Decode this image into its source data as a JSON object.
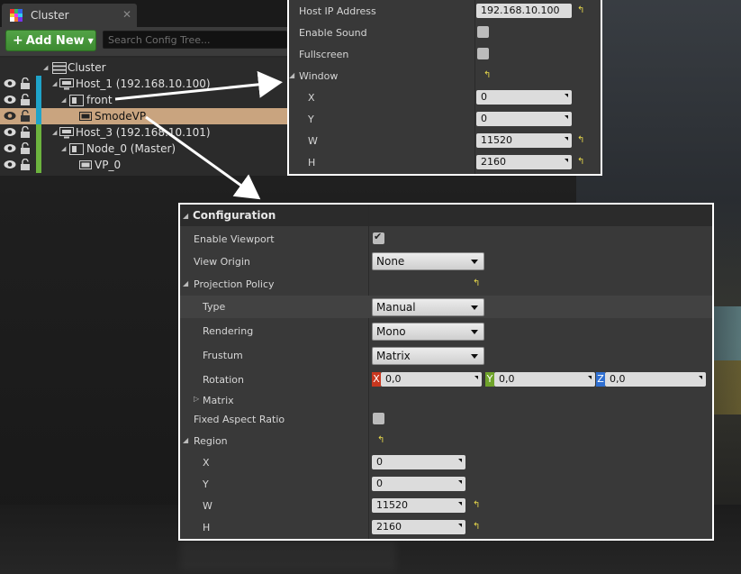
{
  "outliner": {
    "tab_title": "Cluster",
    "tab_close": "✕",
    "add_button": {
      "plus": "+",
      "label": "Add New"
    },
    "search_placeholder": "Search Config Tree...",
    "tree": [
      {
        "label": "Cluster",
        "icon": "cluster-icon"
      },
      {
        "label": "Host_1 (192.168.10.100)",
        "icon": "monitor-icon"
      },
      {
        "label": "front",
        "icon": "window-icon"
      },
      {
        "label": "SmodeVP",
        "icon": "viewport-icon",
        "selected": true
      },
      {
        "label": "Host_3 (192.168.10.101)",
        "icon": "monitor-icon"
      },
      {
        "label": "Node_0 (Master)",
        "icon": "window-icon"
      },
      {
        "label": "VP_0",
        "icon": "viewport-icon"
      }
    ],
    "colors": {
      "host1_bar": "#1fa3c9",
      "host3_bar": "#6cb33e",
      "selected_row": "#c9a47f"
    }
  },
  "node_details": {
    "host_ip_label": "Host IP Address",
    "host_ip_value": "192.168.10.100",
    "enable_sound_label": "Enable Sound",
    "fullscreen_label": "Fullscreen",
    "window_label": "Window",
    "window": {
      "x_label": "X",
      "x_value": "0",
      "y_label": "Y",
      "y_value": "0",
      "w_label": "W",
      "w_value": "11520",
      "h_label": "H",
      "h_value": "2160"
    }
  },
  "configuration": {
    "header": "Configuration",
    "enable_viewport_label": "Enable Viewport",
    "view_origin_label": "View Origin",
    "view_origin_value": "None",
    "projection_policy_label": "Projection Policy",
    "type_label": "Type",
    "type_value": "Manual",
    "rendering_label": "Rendering",
    "rendering_value": "Mono",
    "frustum_label": "Frustum",
    "frustum_value": "Matrix",
    "rotation_label": "Rotation",
    "rotation": {
      "x_axis": "X",
      "x_value": "0,0",
      "y_axis": "Y",
      "y_value": "0,0",
      "z_axis": "Z",
      "z_value": "0,0"
    },
    "matrix_label": "Matrix",
    "fixed_aspect_label": "Fixed Aspect Ratio",
    "region_label": "Region",
    "region": {
      "x_label": "X",
      "x_value": "0",
      "y_label": "Y",
      "y_value": "0",
      "w_label": "W",
      "w_value": "11520",
      "h_label": "H",
      "h_value": "2160"
    },
    "axis_colors": {
      "x": "#c8371f",
      "y": "#6fa32b",
      "z": "#2f6fd1"
    }
  },
  "icons": {
    "eye": "eye-icon",
    "lock": "lock-icon",
    "reset": "reset-to-default-icon",
    "drag": "drag-handle-icon",
    "combo_arrow": "chevron-down-icon"
  }
}
